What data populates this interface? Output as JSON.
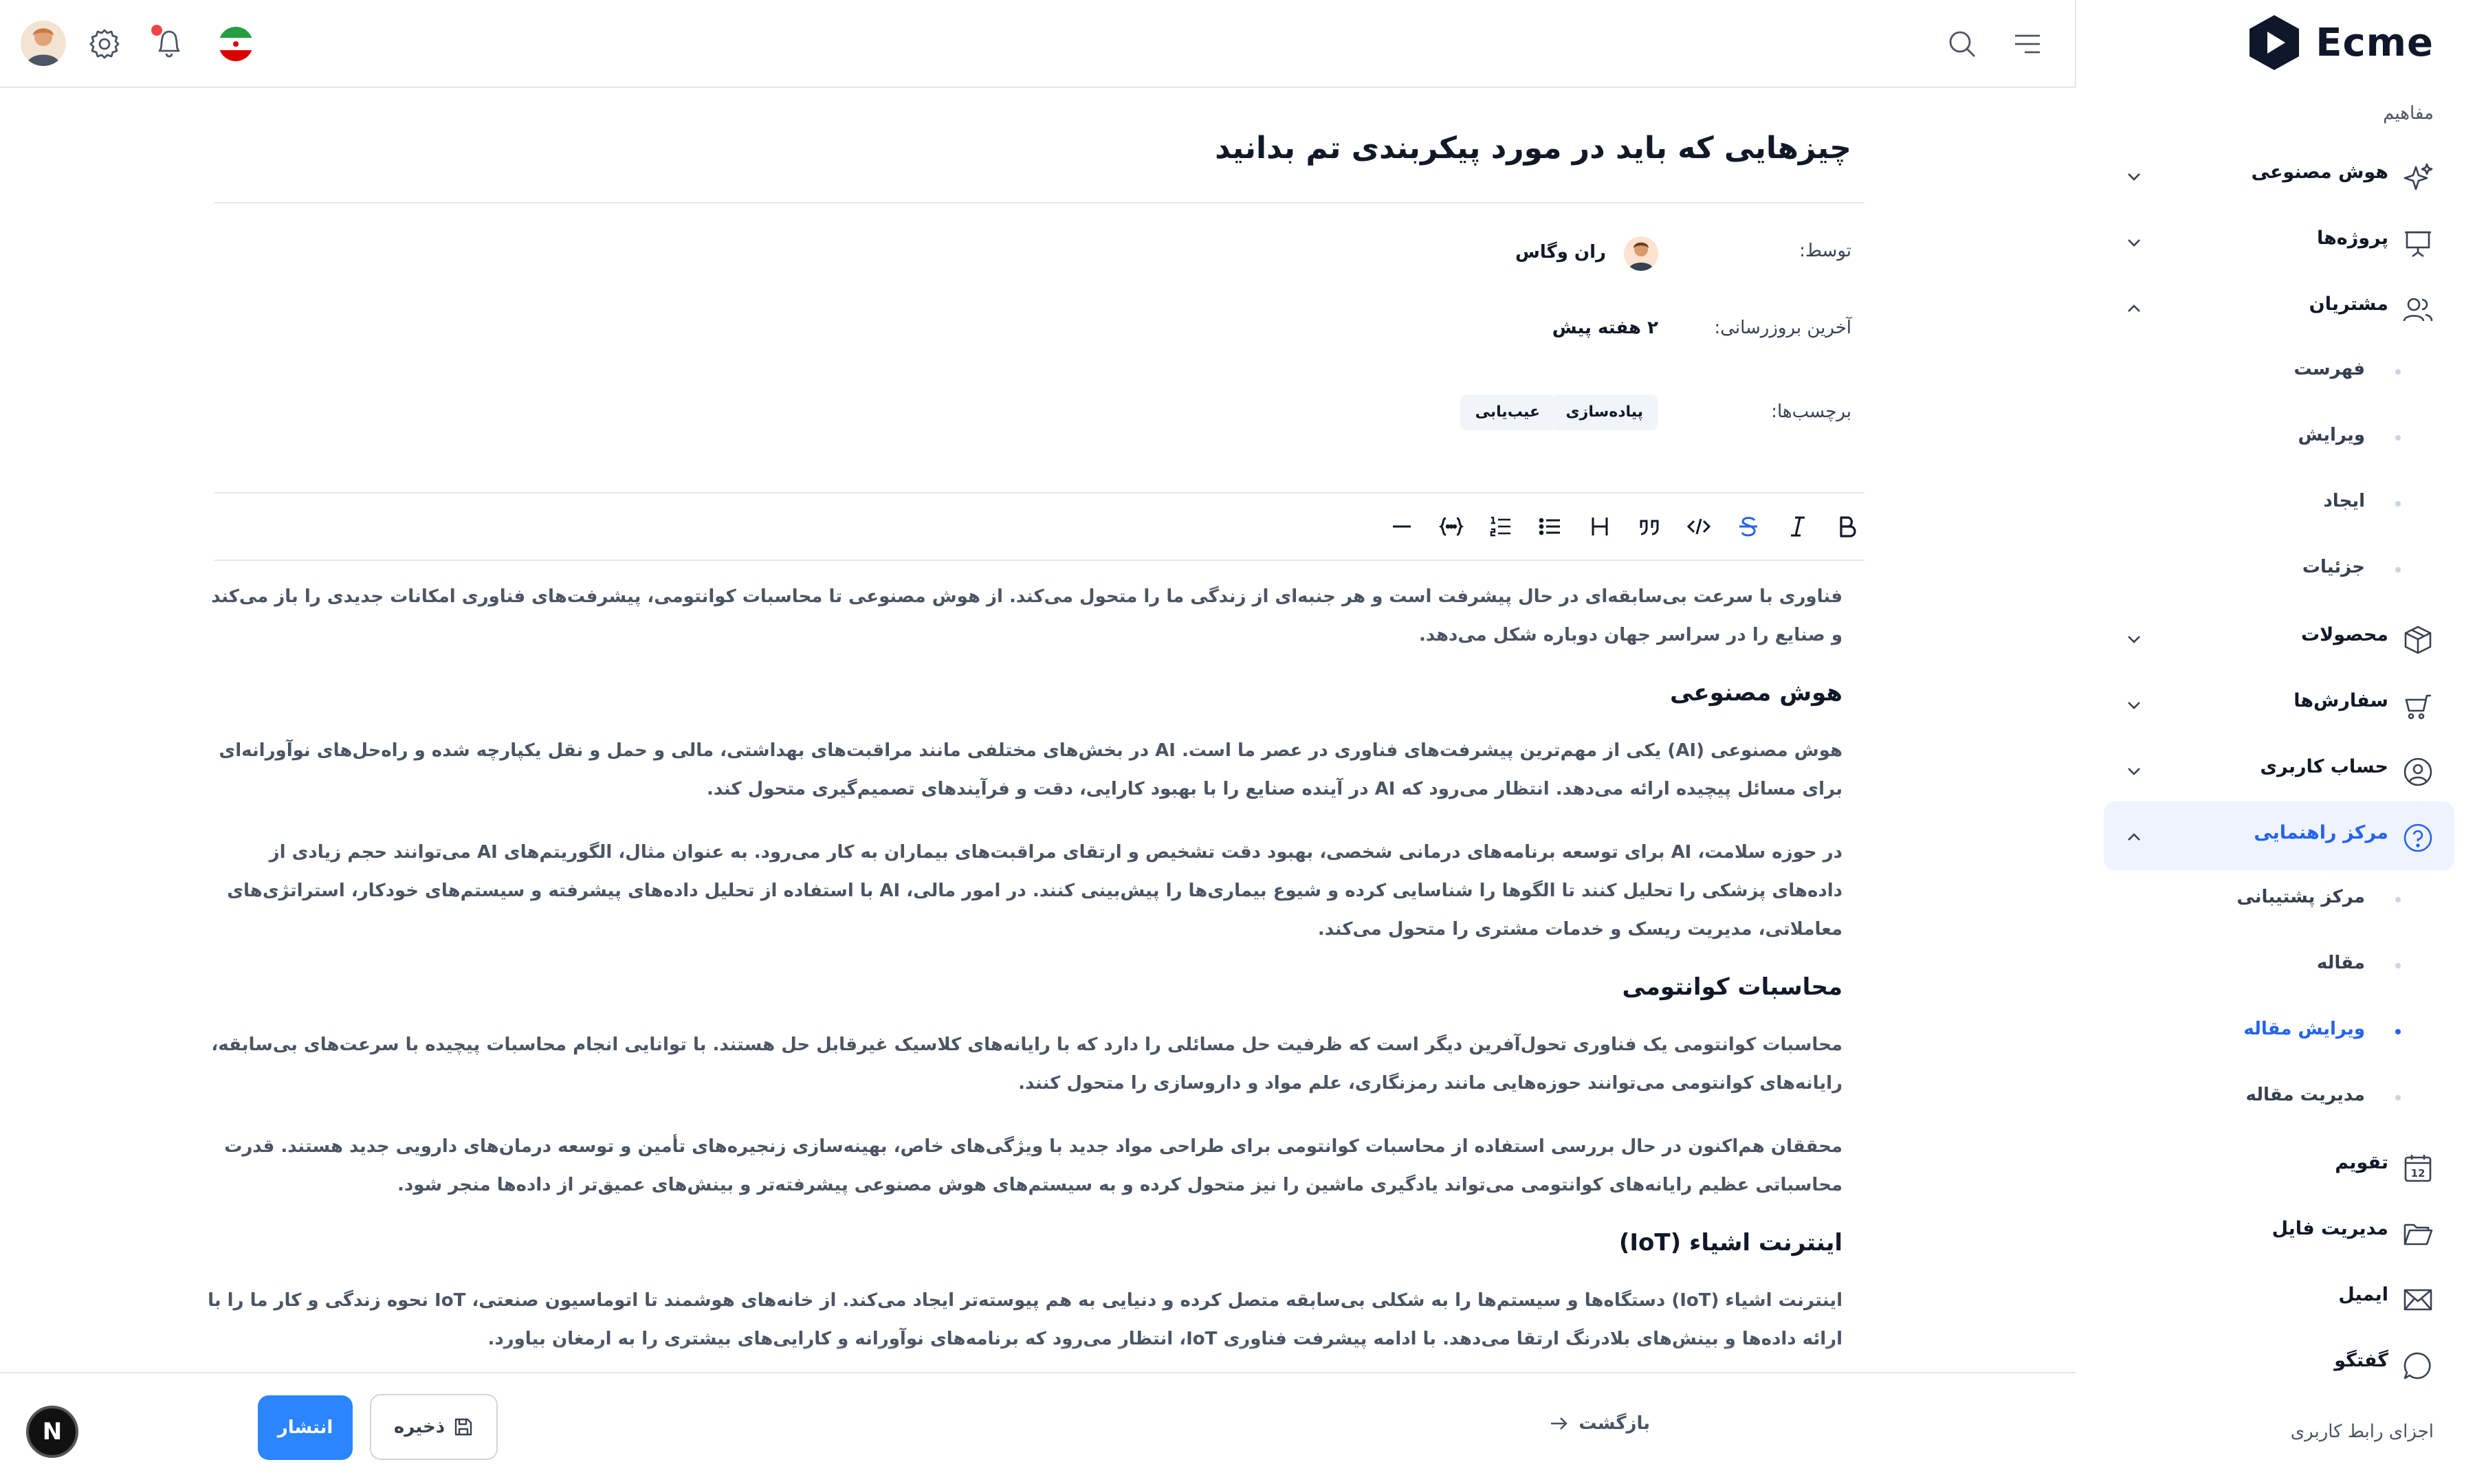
{
  "app": {
    "name": "Ecme"
  },
  "sidebar": {
    "section_title": "مفاهیم",
    "items": [
      {
        "label": "هوش مصنوعی",
        "icon": "sparkle-icon"
      },
      {
        "label": "پروژه‌ها",
        "icon": "presentation-icon"
      },
      {
        "label": "مشتریان",
        "icon": "users-icon"
      },
      {
        "label": "محصولات",
        "icon": "box-icon"
      },
      {
        "label": "سفارش‌ها",
        "icon": "cart-icon"
      },
      {
        "label": "حساب کاربری",
        "icon": "user-circle-icon"
      },
      {
        "label": "مرکز راهنمایی",
        "icon": "help-circle-icon"
      },
      {
        "label": "تقویم",
        "icon": "calendar-icon"
      },
      {
        "label": "مدیریت فایل",
        "icon": "folder-icon"
      },
      {
        "label": "ایمیل",
        "icon": "mail-icon"
      },
      {
        "label": "گفتگو",
        "icon": "chat-icon"
      }
    ],
    "customer_sub": [
      "فهرست",
      "ویرایش",
      "ایجاد",
      "جزئیات"
    ],
    "help_sub": [
      "مرکز پشتیبانی",
      "مقاله",
      "ویرایش مقاله",
      "مدیریت مقاله"
    ],
    "section2_title": "اجزای رابط کاربری",
    "calendar_day": "12"
  },
  "article": {
    "title": "چیزهایی که باید در مورد پیکربندی تم بدانید",
    "by_label": "توسط:",
    "author": "ران وگاس",
    "updated_label": "آخرین بروزرسانی:",
    "updated_value": "۲ هفته پیش",
    "tags_label": "برچسب‌ها:",
    "tags": [
      "پیاده‌سازی",
      "عیب‌یابی"
    ]
  },
  "content": {
    "intro": "فناوری با سرعت بی‌سابقه‌ای در حال پیشرفت است و هر جنبه‌ای از زندگی ما را متحول می‌کند. از هوش مصنوعی تا محاسبات کوانتومی، پیشرفت‌های فناوری امکانات جدیدی را باز می‌کند و صنایع را در سراسر جهان دوباره شکل می‌دهد.",
    "h1": "هوش مصنوعی",
    "p1": "هوش مصنوعی (AI) یکی از مهم‌ترین پیشرفت‌های فناوری در عصر ما است. AI در بخش‌های مختلفی مانند مراقبت‌های بهداشتی، مالی و حمل و نقل یکپارچه شده و راه‌حل‌های نوآورانه‌ای برای مسائل پیچیده ارائه می‌دهد. انتظار می‌رود که AI در آینده صنایع را با بهبود کارایی، دقت و فرآیندهای تصمیم‌گیری متحول کند.",
    "p2": "در حوزه سلامت، AI برای توسعه برنامه‌های درمانی شخصی، بهبود دقت تشخیص و ارتقای مراقبت‌های بیماران به کار می‌رود. به عنوان مثال، الگوریتم‌های AI می‌توانند حجم زیادی از داده‌های پزشکی را تحلیل کنند تا الگوها را شناسایی کرده و شیوع بیماری‌ها را پیش‌بینی کنند. در امور مالی، AI با استفاده از تحلیل داده‌های پیشرفته و سیستم‌های خودکار، استراتژی‌های معاملاتی، مدیریت ریسک و خدمات مشتری را متحول می‌کند.",
    "h2": "محاسبات کوانتومی",
    "p3": "محاسبات کوانتومی یک فناوری تحول‌آفرین دیگر است که ظرفیت حل مسائلی را دارد که با رایانه‌های کلاسیک غیرقابل حل هستند. با توانایی انجام محاسبات پیچیده با سرعت‌های بی‌سابقه، رایانه‌های کوانتومی می‌توانند حوزه‌هایی مانند رمزنگاری، علم مواد و داروسازی را متحول کنند.",
    "p4": "محققان هم‌اکنون در حال بررسی استفاده از محاسبات کوانتومی برای طراحی مواد جدید با ویژگی‌های خاص، بهینه‌سازی زنجیره‌های تأمین و توسعه درمان‌های دارویی جدید هستند. قدرت محاسباتی عظیم رایانه‌های کوانتومی می‌تواند یادگیری ماشین را نیز متحول کرده و به سیستم‌های هوش مصنوعی پیشرفته‌تر و بینش‌های عمیق‌تر از داده‌ها منجر شود.",
    "h3": "اینترنت اشیاء (IoT)",
    "p5": "اینترنت اشیاء (IoT) دستگاه‌ها و سیستم‌ها را به شکلی بی‌سابقه متصل کرده و دنیایی به هم پیوسته‌تر ایجاد می‌کند. از خانه‌های هوشمند تا اتوماسیون صنعتی، IoT نحوه زندگی و کار ما را با ارائه داده‌ها و بینش‌های بلادرنگ ارتقا می‌دهد. با ادامه پیشرفت فناوری IoT، انتظار می‌رود که برنامه‌های نوآورانه و کارایی‌های بیشتری را به ارمغان بیاورد."
  },
  "footer": {
    "back_label": "بازگشت",
    "save_label": "ذخیره",
    "publish_label": "انتشار"
  },
  "badge": {
    "letter": "N"
  },
  "colors": {
    "accent": "#2a85ff",
    "active_bg": "#eef3ff",
    "active_text": "#2563eb"
  }
}
